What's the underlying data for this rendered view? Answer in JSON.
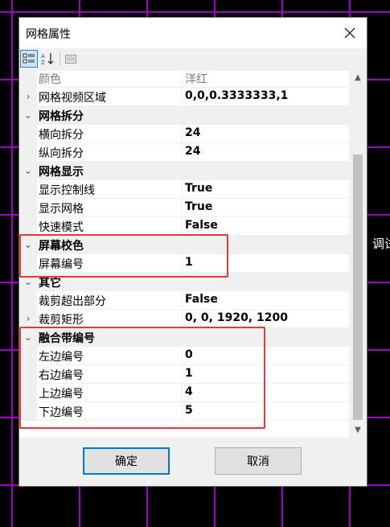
{
  "background_text": "调试",
  "dialog": {
    "title": "网格属性",
    "close_glyph": "✕",
    "toolbar": {
      "categorized_icon": "categorized-icon",
      "alphabetical_icon": "sort-az-icon",
      "property_pages_icon": "property-pages-icon"
    },
    "grid": {
      "rows": [
        {
          "type": "prop",
          "name": "颜色",
          "value": "洋红",
          "muted": true
        },
        {
          "type": "prop",
          "name": "网格视频区域",
          "value": "0,0,0.3333333,1",
          "expandable": true
        },
        {
          "type": "category",
          "name": "网格拆分"
        },
        {
          "type": "prop",
          "name": "横向拆分",
          "value": "24"
        },
        {
          "type": "prop",
          "name": "纵向拆分",
          "value": "24"
        },
        {
          "type": "category",
          "name": "网格显示"
        },
        {
          "type": "prop",
          "name": "显示控制线",
          "value": "True"
        },
        {
          "type": "prop",
          "name": "显示网格",
          "value": "True"
        },
        {
          "type": "prop",
          "name": "快速模式",
          "value": "False"
        },
        {
          "type": "category",
          "name": "屏幕校色"
        },
        {
          "type": "prop",
          "name": "屏幕编号",
          "value": "1"
        },
        {
          "type": "category",
          "name": "其它"
        },
        {
          "type": "prop",
          "name": "裁剪超出部分",
          "value": "False"
        },
        {
          "type": "prop",
          "name": "裁剪矩形",
          "value": "0, 0, 1920, 1200",
          "expandable": true
        },
        {
          "type": "category",
          "name": "融合带编号"
        },
        {
          "type": "prop",
          "name": "左边编号",
          "value": "0"
        },
        {
          "type": "prop",
          "name": "右边编号",
          "value": "1"
        },
        {
          "type": "prop",
          "name": "上边编号",
          "value": "4"
        },
        {
          "type": "prop",
          "name": "下边编号",
          "value": "5"
        }
      ]
    },
    "buttons": {
      "ok": "确定",
      "cancel": "取消"
    }
  },
  "colors": {
    "grid_line": "#a000c8",
    "highlight": "#e53939",
    "accent": "#0078d7"
  }
}
